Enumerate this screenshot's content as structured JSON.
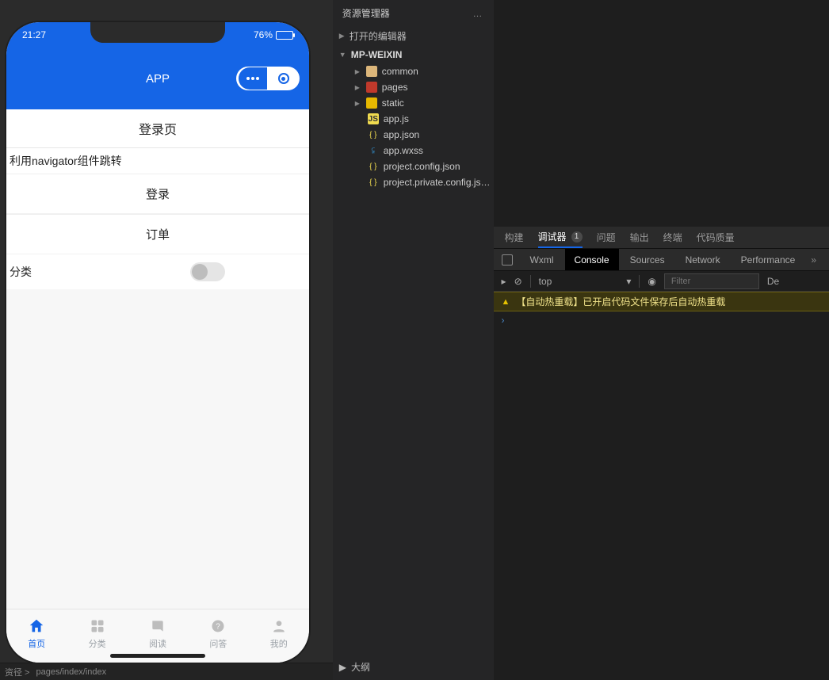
{
  "phone": {
    "status": {
      "time": "21:27",
      "battery_pct": "76%"
    },
    "navbar": {
      "title": "APP"
    },
    "page": {
      "section_title": "登录页",
      "note": "利用navigator组件跳转",
      "btn_login": "登录",
      "btn_order": "订单",
      "switch_label": "分类"
    },
    "tabs": {
      "home": "首页",
      "category": "分类",
      "read": "阅读",
      "qa": "问答",
      "mine": "我的"
    }
  },
  "footer": {
    "path_prefix": "资径 >",
    "path": "pages/index/index"
  },
  "explorer": {
    "title": "资源管理器",
    "sections": {
      "open_editors": "打开的编辑器",
      "project": "MP-WEIXIN",
      "outline": "大纲"
    },
    "folders": {
      "common": "common",
      "pages": "pages",
      "static": "static"
    },
    "files": {
      "appjs": "app.js",
      "appjson": "app.json",
      "appwxss": "app.wxss",
      "projcfg": "project.config.json",
      "projpriv": "project.private.config.js…"
    }
  },
  "devtools": {
    "tabs1": {
      "build": "构建",
      "debugger": "调试器",
      "badge": "1",
      "issues": "问题",
      "output": "输出",
      "terminal": "终端",
      "quality": "代码质量"
    },
    "tabs2": {
      "wxml": "Wxml",
      "console": "Console",
      "sources": "Sources",
      "network": "Network",
      "performance": "Performance"
    },
    "toolbar": {
      "context": "top",
      "filter_placeholder": "Filter",
      "de": "De"
    },
    "console": {
      "warn": "【自动热重载】已开启代码文件保存后自动热重载",
      "prompt": "›"
    }
  }
}
